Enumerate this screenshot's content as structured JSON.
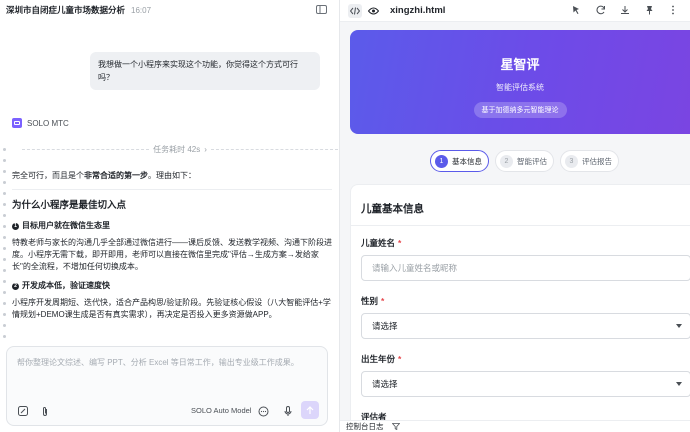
{
  "left": {
    "title": "深圳市自闭症儿童市场数据分析",
    "time": "16:07",
    "user_message": "我想做一个小程序来实现这个功能，你觉得这个方式可行吗？",
    "agent_name": "SOLO MTC",
    "task_time": "任务耗时 42s",
    "msg_intro_1": "完全可行，而且是个",
    "msg_intro_bold": "非常合适的第一步",
    "msg_intro_2": "。理由如下：",
    "h_why": "为什么小程序是最佳切入点",
    "s1_title": "目标用户就在微信生态里",
    "s1_body": "特教老师与家长的沟通几乎全部通过微信进行——课后反馈、发送教学视频、沟通下阶段进度。小程序无需下载，即开即用，老师可以直接在微信里完成\"评估→生成方案→发给家长\"的全流程，不增加任何切换成本。",
    "s2_title": "开发成本低，验证速度快",
    "s2_body": "小程序开发周期短、迭代快，适合产品构思/验证阶段。先验证核心假设（八大智能评估+学情规划+DEMO课生成是否有真实需求），再决定是否投入更多资源做APP。",
    "input_placeholder": "帮你整理论文综述、编写 PPT、分析 Excel 等日常工作，输出专业级工作成果。",
    "model_label": "SOLO Auto Model"
  },
  "right": {
    "file_name": "xingzhi.html",
    "hero": {
      "title": "星智评",
      "subtitle": "智能评估系统",
      "badge": "基于加德纳多元智能理论"
    },
    "steps": [
      {
        "num": "1",
        "label": "基本信息"
      },
      {
        "num": "2",
        "label": "智能评估"
      },
      {
        "num": "3",
        "label": "评估报告"
      }
    ],
    "form": {
      "title": "儿童基本信息",
      "name_label": "儿童姓名",
      "name_placeholder": "请输入儿童姓名或昵称",
      "gender_label": "性别",
      "gender_value": "请选择",
      "birth_label": "出生年份",
      "birth_value": "请选择",
      "next_label": "评估者"
    },
    "console_label": "控制台日志"
  },
  "colors": {
    "accent": "#5b5bea",
    "required": "#e5484d"
  }
}
